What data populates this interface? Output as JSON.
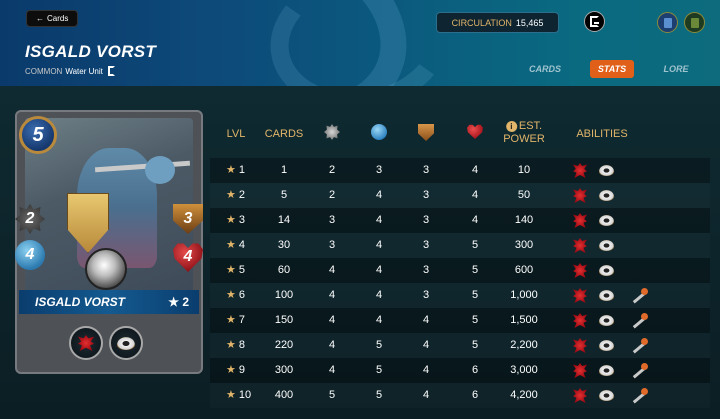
{
  "header": {
    "back_label": "Cards",
    "back_icon": "arrow-left-icon",
    "title": "ISGALD VORST",
    "rarity": "COMMON",
    "subtitle": "Water Unit",
    "circulation_label": "CIRCULATION",
    "circulation_value": "15,465",
    "tabs": [
      {
        "label": "CARDS",
        "active": false
      },
      {
        "label": "STATS",
        "active": true
      },
      {
        "label": "LORE",
        "active": false
      }
    ]
  },
  "card": {
    "name": "ISGALD VORST",
    "mana": "5",
    "melee": "2",
    "magic": "4",
    "armor": "3",
    "health": "4",
    "level": "★ 2",
    "abilities": [
      "bug-icon",
      "eye-icon"
    ]
  },
  "table": {
    "headers": {
      "lvl": "LVL",
      "cards": "CARDS",
      "power_line1": "EST.",
      "power_line2": "POWER",
      "abilities": "ABILITIES",
      "info_glyph": "i"
    },
    "rows": [
      {
        "lvl": "1",
        "cards": "1",
        "melee": "2",
        "magic": "3",
        "armor": "3",
        "health": "4",
        "power": "10",
        "abilities": [
          "bug",
          "eye"
        ]
      },
      {
        "lvl": "2",
        "cards": "5",
        "melee": "2",
        "magic": "4",
        "armor": "3",
        "health": "4",
        "power": "50",
        "abilities": [
          "bug",
          "eye"
        ]
      },
      {
        "lvl": "3",
        "cards": "14",
        "melee": "3",
        "magic": "4",
        "armor": "3",
        "health": "4",
        "power": "140",
        "abilities": [
          "bug",
          "eye"
        ]
      },
      {
        "lvl": "4",
        "cards": "30",
        "melee": "3",
        "magic": "4",
        "armor": "3",
        "health": "5",
        "power": "300",
        "abilities": [
          "bug",
          "eye"
        ]
      },
      {
        "lvl": "5",
        "cards": "60",
        "melee": "4",
        "magic": "4",
        "armor": "3",
        "health": "5",
        "power": "600",
        "abilities": [
          "bug",
          "eye"
        ]
      },
      {
        "lvl": "6",
        "cards": "100",
        "melee": "4",
        "magic": "4",
        "armor": "3",
        "health": "5",
        "power": "1,000",
        "abilities": [
          "bug",
          "eye",
          "wand"
        ]
      },
      {
        "lvl": "7",
        "cards": "150",
        "melee": "4",
        "magic": "4",
        "armor": "4",
        "health": "5",
        "power": "1,500",
        "abilities": [
          "bug",
          "eye",
          "wand"
        ]
      },
      {
        "lvl": "8",
        "cards": "220",
        "melee": "4",
        "magic": "5",
        "armor": "4",
        "health": "5",
        "power": "2,200",
        "abilities": [
          "bug",
          "eye",
          "wand"
        ]
      },
      {
        "lvl": "9",
        "cards": "300",
        "melee": "4",
        "magic": "5",
        "armor": "4",
        "health": "6",
        "power": "3,000",
        "abilities": [
          "bug",
          "eye",
          "wand"
        ]
      },
      {
        "lvl": "10",
        "cards": "400",
        "melee": "5",
        "magic": "5",
        "armor": "4",
        "health": "6",
        "power": "4,200",
        "abilities": [
          "bug",
          "eye",
          "wand"
        ]
      }
    ]
  },
  "colors": {
    "accent": "#e0601a",
    "gold": "#e1b56a",
    "header_blue": "#0a3a6b"
  }
}
